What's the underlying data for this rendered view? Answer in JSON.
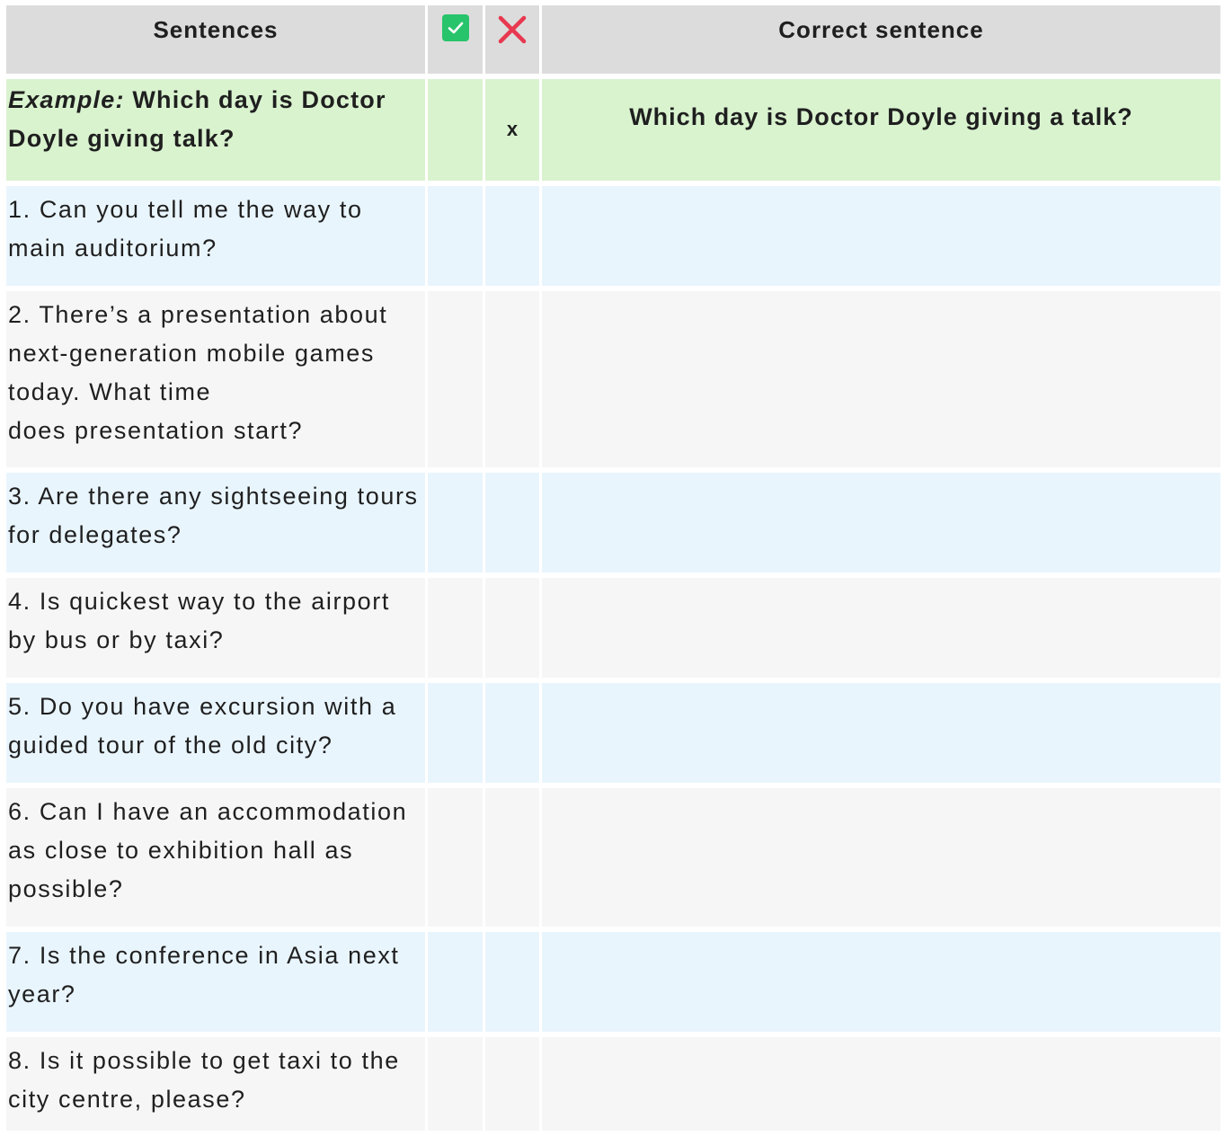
{
  "header": {
    "sentences": "Sentences",
    "correct_icon": "check-box-icon",
    "incorrect_icon": "cross-icon",
    "correct_sentence": "Correct sentence",
    "colors": {
      "header_bg": "#dcdcdc",
      "check_green": "#27c46b",
      "cross_red": "#e8384f"
    }
  },
  "example": {
    "label": "Example:",
    "sentence": "Which day is Doctor Doyle giving talk?",
    "mark": "x",
    "correction": "Which day is Doctor Doyle giving a talk?",
    "color": "#d9f3cf"
  },
  "rows": [
    {
      "text": "1. Can you tell me the way to main auditorium?",
      "style": "blue",
      "height": 111
    },
    {
      "text": "2. There’s a presentation about next-generation mobile games today. What time\ndoes presentation start?",
      "style": "grey",
      "height": 196
    },
    {
      "text": "3. Are there any sightseeing tours for delegates?",
      "style": "blue",
      "height": 111
    },
    {
      "text": "4. Is quickest way to the airport by bus or by taxi?",
      "style": "grey",
      "height": 111
    },
    {
      "text": "5. Do you have excursion with a guided tour of the old city?",
      "style": "blue",
      "height": 111
    },
    {
      "text": "6. Can I have an accommodation as close to exhibition hall as possible?",
      "style": "grey",
      "height": 154
    },
    {
      "text": "7. Is the conference in Asia next year?",
      "style": "blue",
      "height": 111
    },
    {
      "text": "8. Is it possible to get taxi to the city centre, please?",
      "style": "grey",
      "height": 104
    }
  ]
}
